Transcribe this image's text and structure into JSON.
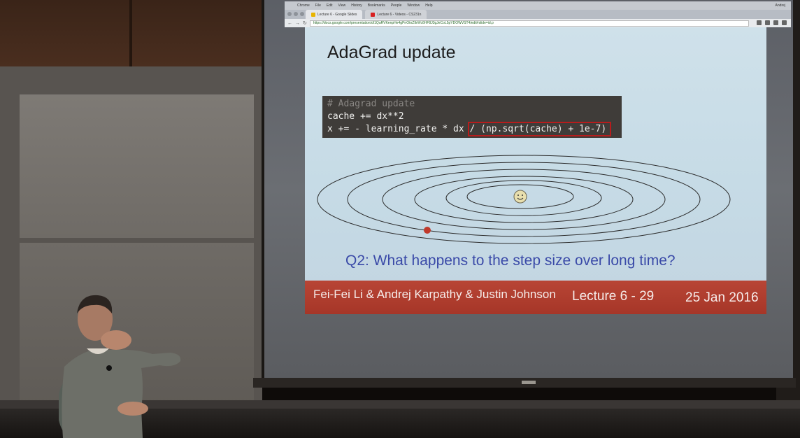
{
  "browser": {
    "menu": [
      "Chrome",
      "File",
      "Edit",
      "View",
      "History",
      "Bookmarks",
      "People",
      "Window",
      "Help"
    ],
    "user": "Andrej",
    "tabs": [
      {
        "label": "Lecture 6 - Google Slides",
        "icon": "slides-icon",
        "active": true
      },
      {
        "label": "Lecture 6 - Videos - CS231n",
        "icon": "youtube-icon",
        "active": false
      }
    ],
    "url": "https://docs.google.com/presentation/d/1QaRVKenpHe4gPnOtnZ9rWc6HF8J3gJeCoL5pYDOWVST4/edit#slide=id.p"
  },
  "slide": {
    "title": "AdaGrad update",
    "code": {
      "comment": "# Adagrad update",
      "line1": "cache += dx**2",
      "line2_pre": "x += - learning_rate * dx ",
      "line2_highlight": "/ (np.sqrt(cache) + 1e-7)"
    },
    "question": "Q2: What happens to the step size over long time?",
    "footer": {
      "authors": "Fei-Fei Li & Andrej Karpathy & Justin Johnson",
      "lecture": "Lecture 6 - 29",
      "date": "25 Jan 2016"
    },
    "colors": {
      "slide_background": "#c6dbe6",
      "code_background": "#3f3c39",
      "highlight_box": "#b71c1c",
      "question_text": "#3a4aa8",
      "footer_band": "#a63628",
      "start_dot": "#c0392b",
      "optimum_face": "#e8dfae"
    },
    "diagram": {
      "contour_count": 6,
      "start_marker": "red-dot",
      "optimum_marker": "smiley-face-icon"
    }
  }
}
